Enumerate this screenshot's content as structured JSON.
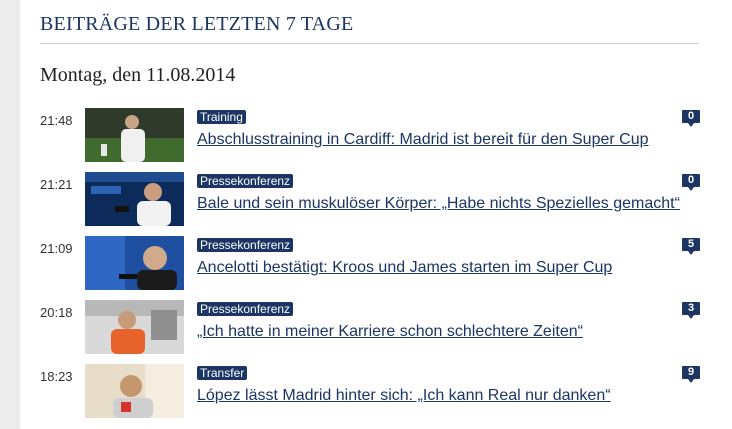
{
  "section": {
    "title": "BEITRÄGE DER LETZTEN 7 TAGE"
  },
  "date_heading": "Montag, den 11.08.2014",
  "posts": [
    {
      "time": "21:48",
      "tag": "Training",
      "headline": "Abschlusstraining in Cardiff: Madrid ist bereit für den Super Cup",
      "comments": "0"
    },
    {
      "time": "21:21",
      "tag": "Pressekonferenz",
      "headline": "Bale und sein muskulöser Körper: „Habe nichts Spezielles gemacht“",
      "comments": "0"
    },
    {
      "time": "21:09",
      "tag": "Pressekonferenz",
      "headline": "Ancelotti bestätigt: Kroos und James starten im Super Cup",
      "comments": "5"
    },
    {
      "time": "20:18",
      "tag": "Pressekonferenz",
      "headline": "„Ich hatte in meiner Karriere schon schlechtere Zeiten“",
      "comments": "3"
    },
    {
      "time": "18:23",
      "tag": "Transfer",
      "headline": "López lässt Madrid hinter sich: „Ich kann Real nur danken“",
      "comments": "9"
    }
  ],
  "colors": {
    "accent": "#1b3564",
    "rule": "#cfcfcf",
    "stripe": "#ececec"
  }
}
